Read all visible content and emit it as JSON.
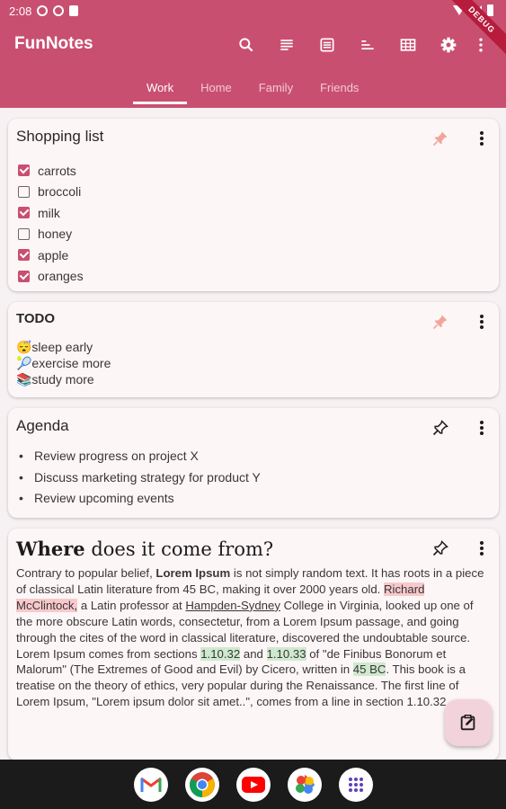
{
  "status": {
    "time": "2:08"
  },
  "appbar": {
    "title": "FunNotes",
    "debug": "DEBUG"
  },
  "tabs": [
    {
      "label": "Work"
    },
    {
      "label": "Home"
    },
    {
      "label": "Family"
    },
    {
      "label": "Friends"
    }
  ],
  "notes": {
    "shopping": {
      "title": "Shopping list",
      "items": [
        {
          "label": "carrots",
          "checked": true
        },
        {
          "label": "broccoli",
          "checked": false
        },
        {
          "label": "milk",
          "checked": true
        },
        {
          "label": "honey",
          "checked": false
        },
        {
          "label": "apple",
          "checked": true
        },
        {
          "label": "oranges",
          "checked": true
        }
      ]
    },
    "todo": {
      "title": "TODO",
      "lines": [
        "😴sleep early",
        "🎾exercise more",
        "📚study more"
      ]
    },
    "agenda": {
      "title": "Agenda",
      "items": [
        "Review progress on project X",
        "Discuss marketing strategy for product Y",
        "Review upcoming events"
      ]
    },
    "article": {
      "title_bold": "Where",
      "title_rest": " does it come from?",
      "p1": "Contrary to popular belief, ",
      "p1_bold": "Lorem Ipsum",
      "p2": " is not simply random text. It has roots in a piece of classical Latin literature from 45 BC, making it over 2000 years old. ",
      "hl_name": "Richard McClintock,",
      "p3": " a Latin professor at ",
      "underline": "Hampden-Sydney",
      "p4": " College in Virginia, looked up one of the more obscure Latin words, consectetur, from a Lorem Ipsum passage, and going through the cites of the word in classical literature, discovered the undoubtable source. Lorem Ipsum comes from sections ",
      "hl_s1": "1.10.32",
      "p5": " and ",
      "hl_s2": "1.10.33",
      "p6": " of \"de Finibus Bonorum et Malorum\" (The Extremes of Good and Evil) by Cicero, written in ",
      "hl_bc": "45 BC",
      "p7": ". This book is a treatise on the theory of ethics, very popular during the Renaissance. The first line of Lorem Ipsum, \"Lorem ipsum dolor sit amet..\", comes from a line in section 1.10.32."
    }
  },
  "colors": {
    "primary": "#c94f70",
    "pinned": "#f2a59b",
    "card": "#fdf6f7"
  },
  "dock": [
    "gmail-icon",
    "chrome-icon",
    "youtube-icon",
    "photos-icon",
    "apps-icon"
  ]
}
